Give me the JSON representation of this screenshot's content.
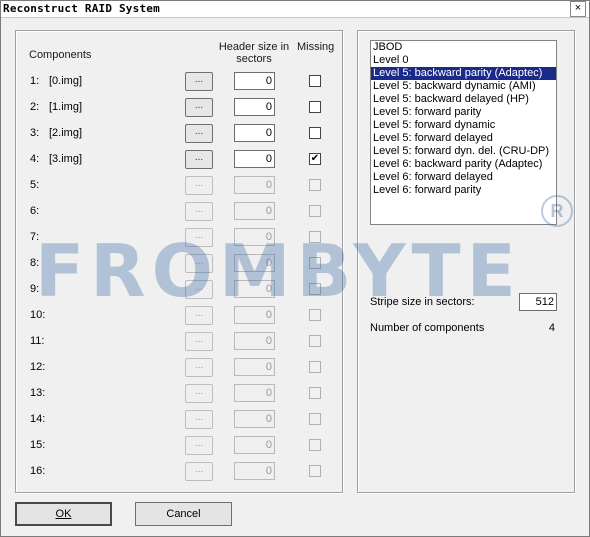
{
  "window": {
    "title": "Reconstruct RAID System",
    "close_glyph": "×"
  },
  "left": {
    "col_components": "Components",
    "col_header_line1": "Header size in",
    "col_header_line2": "sectors",
    "col_missing": "Missing",
    "browse_label": "...",
    "rows": [
      {
        "num": "1:",
        "name": "[0.img]",
        "header": "0",
        "missing": false,
        "enabled": true
      },
      {
        "num": "2:",
        "name": "[1.img]",
        "header": "0",
        "missing": false,
        "enabled": true
      },
      {
        "num": "3:",
        "name": "[2.img]",
        "header": "0",
        "missing": false,
        "enabled": true
      },
      {
        "num": "4:",
        "name": "[3.img]",
        "header": "0",
        "missing": true,
        "enabled": true
      },
      {
        "num": "5:",
        "name": "",
        "header": "0",
        "missing": false,
        "enabled": false
      },
      {
        "num": "6:",
        "name": "",
        "header": "0",
        "missing": false,
        "enabled": false
      },
      {
        "num": "7:",
        "name": "",
        "header": "0",
        "missing": false,
        "enabled": false
      },
      {
        "num": "8:",
        "name": "",
        "header": "0",
        "missing": false,
        "enabled": false
      },
      {
        "num": "9:",
        "name": "",
        "header": "0",
        "missing": false,
        "enabled": false
      },
      {
        "num": "10:",
        "name": "",
        "header": "0",
        "missing": false,
        "enabled": false
      },
      {
        "num": "11:",
        "name": "",
        "header": "0",
        "missing": false,
        "enabled": false
      },
      {
        "num": "12:",
        "name": "",
        "header": "0",
        "missing": false,
        "enabled": false
      },
      {
        "num": "13:",
        "name": "",
        "header": "0",
        "missing": false,
        "enabled": false
      },
      {
        "num": "14:",
        "name": "",
        "header": "0",
        "missing": false,
        "enabled": false
      },
      {
        "num": "15:",
        "name": "",
        "header": "0",
        "missing": false,
        "enabled": false
      },
      {
        "num": "16:",
        "name": "",
        "header": "0",
        "missing": false,
        "enabled": false
      }
    ]
  },
  "right": {
    "raid_levels": [
      "JBOD",
      "Level 0",
      "Level 5: backward parity (Adaptec)",
      "Level 5: backward dynamic (AMI)",
      "Level 5: backward delayed (HP)",
      "Level 5: forward parity",
      "Level 5: forward dynamic",
      "Level 5: forward delayed",
      "Level 5: forward dyn. del. (CRU-DP)",
      "Level 6: backward parity (Adaptec)",
      "Level 6: forward delayed",
      "Level 6: forward parity"
    ],
    "selected_index": 2,
    "stripe_label": "Stripe size in sectors:",
    "stripe_value": "512",
    "ncomp_label": "Number of components",
    "ncomp_value": "4"
  },
  "buttons": {
    "ok": "OK",
    "cancel": "Cancel"
  },
  "watermark": {
    "text": "FROMBYTE",
    "mark": "R"
  },
  "colors": {
    "selection": "#1b2a8a",
    "watermark": "#406ea5"
  }
}
